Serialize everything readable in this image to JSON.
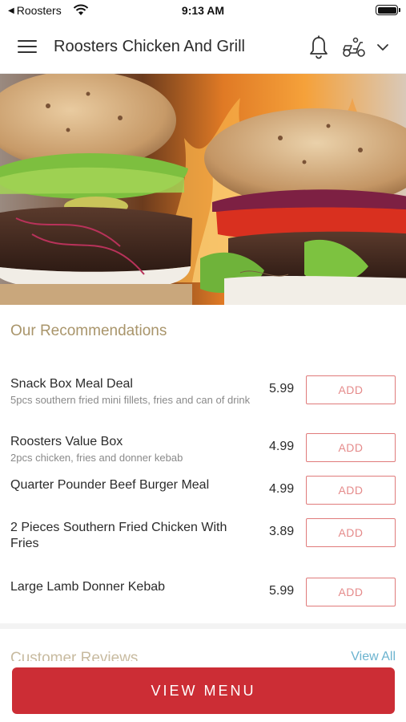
{
  "status_bar": {
    "back_app": "Roosters",
    "time": "9:13 AM"
  },
  "header": {
    "title": "Roosters Chicken And Grill",
    "icons": [
      "menu-icon",
      "bell-icon",
      "delivery-scooter-icon",
      "chevron-down-icon"
    ]
  },
  "recommendations": {
    "title": "Our Recommendations",
    "items": [
      {
        "name": "Snack Box Meal Deal",
        "description": "5pcs southern fried mini fillets, fries and can of drink",
        "price": "5.99",
        "button": "ADD"
      },
      {
        "name": "Roosters Value Box",
        "description": "2pcs chicken, fries and donner kebab",
        "price": "4.99",
        "button": "ADD"
      },
      {
        "name": "Quarter Pounder Beef Burger Meal",
        "description": "",
        "price": "4.99",
        "button": "ADD"
      },
      {
        "name": "2 Pieces Southern Fried Chicken With Fries",
        "description": "",
        "price": "3.89",
        "button": "ADD"
      },
      {
        "name": "Large Lamb Donner Kebab",
        "description": "",
        "price": "5.99",
        "button": "ADD"
      }
    ]
  },
  "reviews": {
    "title": "Customer Reviews",
    "view_all": "View All"
  },
  "footer": {
    "view_menu": "VIEW MENU"
  },
  "colors": {
    "accent_red": "#cc2d35",
    "section_title": "#a9956b",
    "link_blue": "#6bb3cf"
  }
}
